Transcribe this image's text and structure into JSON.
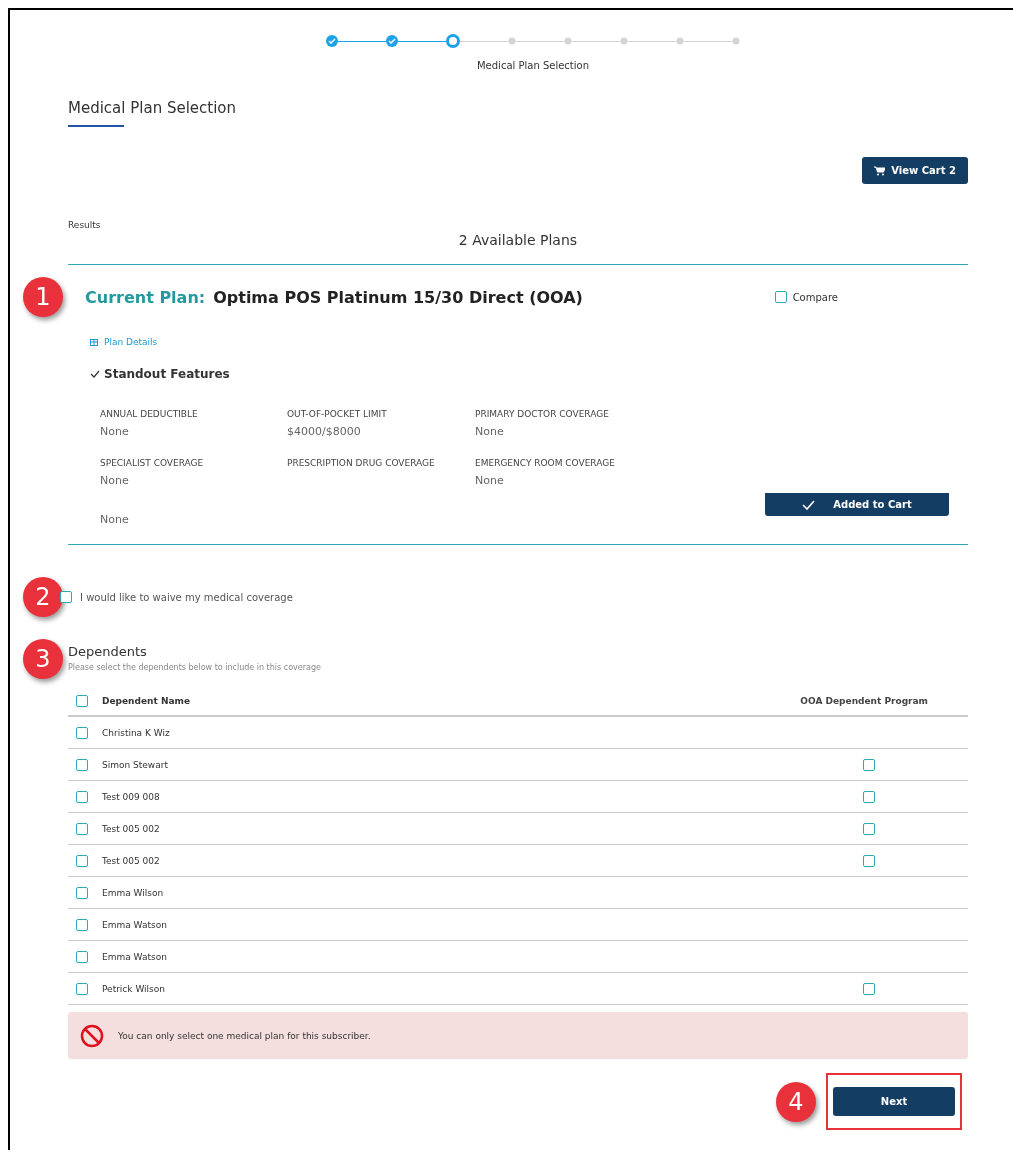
{
  "stepper": {
    "steps": [
      {
        "completed": true,
        "selected": false
      },
      {
        "completed": true,
        "selected": false
      },
      {
        "completed": false,
        "selected": true
      },
      {
        "completed": false,
        "selected": false
      },
      {
        "completed": false,
        "selected": false
      },
      {
        "completed": false,
        "selected": false
      },
      {
        "completed": false,
        "selected": false
      },
      {
        "completed": false,
        "selected": false
      }
    ],
    "current_label": "Medical Plan Selection"
  },
  "page_title": "Medical Plan Selection",
  "view_cart_button": "View Cart 2",
  "results_label": "Results",
  "results_count": "2 Available Plans",
  "plan": {
    "callout": "1",
    "prefix": "Current Plan:",
    "name": "Optima POS Platinum 15/30 Direct (OOA)",
    "compare": {
      "label": "Compare",
      "checked": false
    },
    "details_link": "Plan Details",
    "features_title": "Standout Features",
    "features": [
      {
        "label": "ANNUAL DEDUCTIBLE",
        "value": "None"
      },
      {
        "label": "OUT-OF-POCKET LIMIT",
        "value": "$4000/$8000"
      },
      {
        "label": "PRIMARY DOCTOR COVERAGE",
        "value": "None"
      },
      {
        "label": "SPECIALIST COVERAGE",
        "value": "None"
      },
      {
        "label": "PRESCRIPTION DRUG COVERAGE"
      },
      {
        "label": "EMERGENCY ROOM COVERAGE",
        "value": "None"
      },
      {
        "value": "None"
      }
    ],
    "cart_button": "Added to Cart"
  },
  "waiver": {
    "callout": "2",
    "label": "I would like to waive my medical coverage",
    "checked": false
  },
  "dependents": {
    "callout": "3",
    "title": "Dependents",
    "subtitle": "Please select the dependents below to include in this coverage",
    "select_all_checked": false,
    "columns": [
      "Dependent Name",
      "OOA Dependent Program"
    ],
    "rows": [
      {
        "name": "Christina K Wiz",
        "checked": false
      },
      {
        "name": "Simon Stewart",
        "checked": false,
        "ooa": {
          "checked": false
        }
      },
      {
        "name": "Test 009 008",
        "checked": false,
        "ooa": {
          "checked": false
        }
      },
      {
        "name": "Test 005 002",
        "checked": false,
        "ooa": {
          "checked": false
        }
      },
      {
        "name": "Test 005 002",
        "checked": false,
        "ooa": {
          "checked": false
        }
      },
      {
        "name": "Emma Wilson",
        "checked": false
      },
      {
        "name": "Emma Watson",
        "checked": false
      },
      {
        "name": "Emma Watson",
        "checked": false
      },
      {
        "name": "Petrick Wilson",
        "checked": false,
        "ooa": {
          "checked": false
        }
      }
    ]
  },
  "alert": "You can only select one medical plan for this subscriber.",
  "next_button": {
    "label": "Next",
    "callout": "4",
    "highlighted": true
  }
}
